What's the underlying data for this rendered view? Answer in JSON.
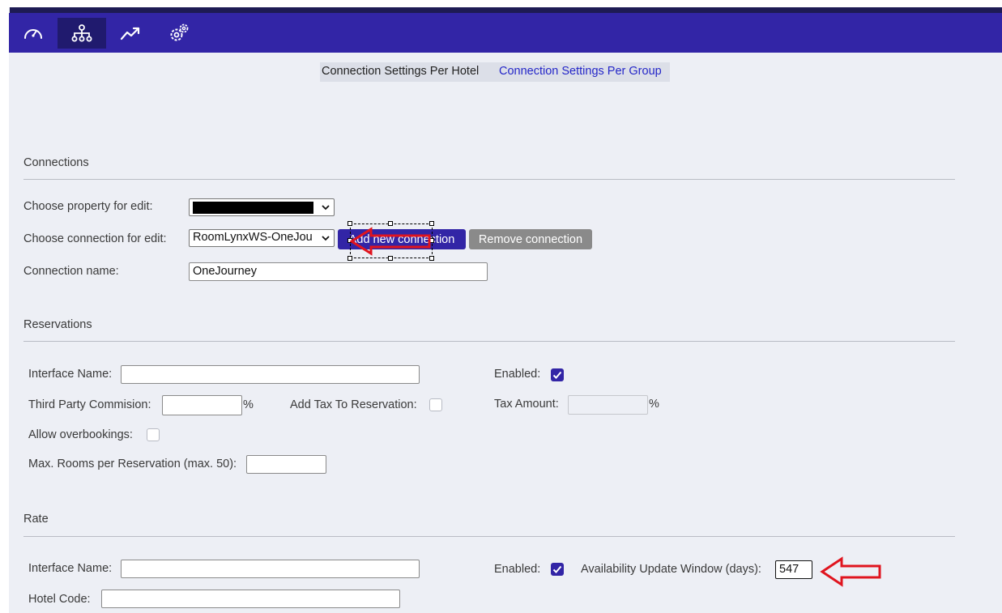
{
  "nav": {
    "items": [
      {
        "icon": "dashboard-gauge-icon",
        "active": false
      },
      {
        "icon": "network-connections-icon",
        "active": true
      },
      {
        "icon": "trending-up-icon",
        "active": false
      },
      {
        "icon": "settings-gears-icon",
        "active": false
      }
    ]
  },
  "tabs": {
    "per_hotel": "Connection Settings Per Hotel",
    "per_group": "Connection Settings Per Group"
  },
  "connections": {
    "title": "Connections",
    "property_label": "Choose property for edit:",
    "property_value": "",
    "connection_label": "Choose connection for edit:",
    "connection_value": "RoomLynxWS-OneJou",
    "add_button": "Add new connection",
    "remove_button": "Remove connection",
    "name_label": "Connection name:",
    "name_value": "OneJourney"
  },
  "reservations": {
    "title": "Reservations",
    "interface_name_label": "Interface Name:",
    "interface_name_value": "",
    "enabled_label": "Enabled:",
    "enabled": true,
    "commission_label": "Third Party Commision:",
    "commission_value": "",
    "percent_symbol": "%",
    "add_tax_label": "Add Tax To Reservation:",
    "add_tax": false,
    "tax_amount_label": "Tax Amount:",
    "tax_amount_value": "",
    "tax_percent_symbol": "%",
    "overbookings_label": "Allow overbookings:",
    "overbookings": false,
    "max_rooms_label": "Max. Rooms per Reservation (max. 50):",
    "max_rooms_value": ""
  },
  "rate": {
    "title": "Rate",
    "interface_name_label": "Interface Name:",
    "interface_name_value": "",
    "enabled_label": "Enabled:",
    "enabled": true,
    "availability_label": "Availability Update Window (days):",
    "availability_value": "547",
    "hotel_code_label": "Hotel Code:",
    "hotel_code_value": ""
  },
  "colors": {
    "nav_bg": "#3225a6",
    "accent": "#3225a6",
    "annotation": "#e0141e",
    "content_bg": "#edeff5"
  }
}
